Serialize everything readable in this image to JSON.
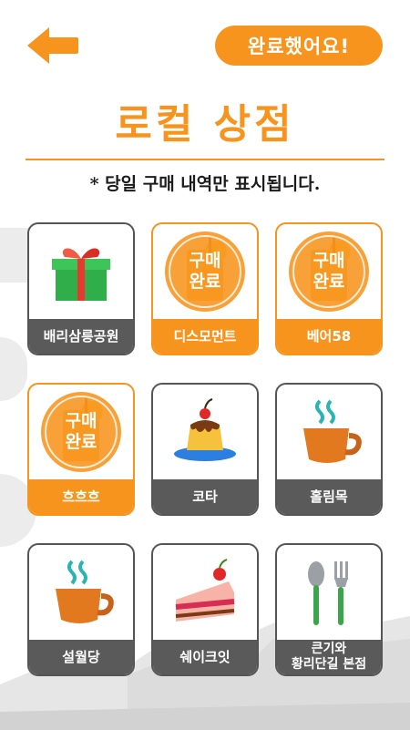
{
  "header": {
    "done_label": "완료했어요!",
    "title": "로컬 상점",
    "notice": "* 당일 구매 내역만 표시됩니다."
  },
  "stamp": {
    "label": "구매 완료"
  },
  "colors": {
    "accent": "#f7941d",
    "label_gray": "#5a5a5a"
  },
  "stores": [
    {
      "label": "배리삼릉공원",
      "icon": "gift-icon",
      "purchased": false
    },
    {
      "label": "디스모먼트",
      "icon": "orange-drink-icon",
      "purchased": true
    },
    {
      "label": "베어58",
      "icon": "orange-drink-icon",
      "purchased": true
    },
    {
      "label": "흐흐흐",
      "icon": "orange-drink-icon",
      "purchased": true
    },
    {
      "label": "코타",
      "icon": "pudding-icon",
      "purchased": false
    },
    {
      "label": "홀림목",
      "icon": "hot-coffee-cup-icon",
      "purchased": false
    },
    {
      "label": "설월당",
      "icon": "hot-coffee-cup-icon",
      "purchased": false
    },
    {
      "label": "쉐이크잇",
      "icon": "cake-slice-icon",
      "purchased": false
    },
    {
      "label": "큰기와\n황리단길 본점",
      "icon": "spoon-fork-icon",
      "purchased": false
    }
  ]
}
